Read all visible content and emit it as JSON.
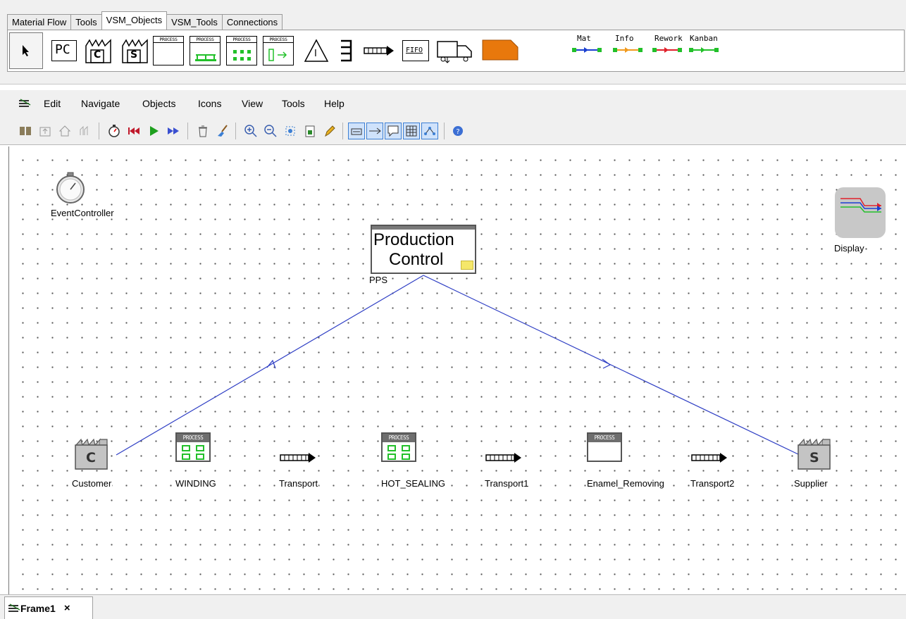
{
  "palette": {
    "tabs": [
      "Material Flow",
      "Tools",
      "VSM_Objects",
      "VSM_Tools",
      "Connections"
    ],
    "active_tab": "VSM_Objects",
    "pc_label": "PC",
    "customer_letter": "C",
    "supplier_letter": "S",
    "process_caption": "PROCESS",
    "fifo_label": "FIFO",
    "inventory_letter": "I",
    "legend": [
      {
        "label": "Mat",
        "color": "#1a3fd0"
      },
      {
        "label": "Info",
        "color": "#f19a1e"
      },
      {
        "label": "Rework",
        "color": "#e0202a"
      },
      {
        "label": "Kanban",
        "color": "#22c02a"
      }
    ]
  },
  "menu": {
    "items": [
      "Edit",
      "Navigate",
      "Objects",
      "Icons",
      "View",
      "Tools",
      "Help"
    ]
  },
  "toolbar": {
    "icons": [
      "explorer-icon",
      "up-level-icon",
      "home-icon",
      "model-icon",
      "event-controller-icon",
      "reset-icon",
      "start-icon",
      "step-icon",
      "delete-icon",
      "clean-icon",
      "zoom-in-icon",
      "zoom-out-icon",
      "fit-icon",
      "snapshot-icon",
      "edit-icon",
      "frame-toggle-icon",
      "connector-toggle-icon",
      "comment-toggle-icon",
      "grid-toggle-icon",
      "network-toggle-icon",
      "help-icon"
    ]
  },
  "canvas": {
    "event_controller": "EventController",
    "display": "Display",
    "production_control": {
      "line1": "Production",
      "line2": "Control",
      "name": "PPS"
    },
    "customer": {
      "letter": "C",
      "name": "Customer"
    },
    "supplier": {
      "letter": "S",
      "name": "Supplier"
    },
    "processes": [
      {
        "header": "PROCESS",
        "name": "WINDING"
      },
      {
        "header": "PROCESS",
        "name": "HOT_SEALING"
      },
      {
        "header": "PROCESS",
        "name": "Enamel_Removing"
      }
    ],
    "transports": [
      "Transport",
      "Transport1",
      "Transport2"
    ],
    "connection_color": "#2e3ec4"
  },
  "bottom": {
    "frame_tab": "Frame1",
    "close": "×"
  }
}
